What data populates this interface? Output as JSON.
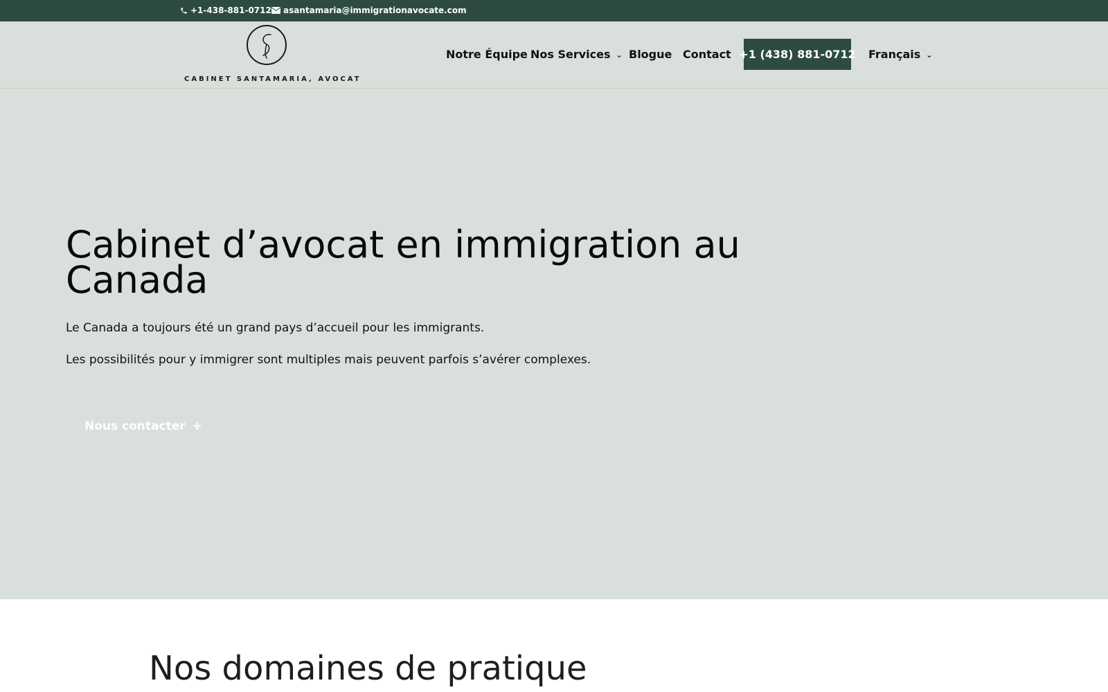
{
  "topbar": {
    "phone": "+1-438-881-0712",
    "email": "asantamaria@immigrationavocate.com",
    "phone_icon": "phone-icon",
    "email_icon": "envelope-icon"
  },
  "header": {
    "logo_text": "CABINET SANTAMARIA, AVOCAT",
    "nav": {
      "team": "Notre Équipe",
      "services": "Nos Services",
      "blog": "Blogue",
      "contact": "Contact",
      "cta_phone": "+1 (438) 881-0712",
      "language": "Français"
    }
  },
  "hero": {
    "title": "Cabinet d’avocat en immigration au Canada",
    "paragraph1": "Le Canada a toujours été un grand pays d’accueil pour les immigrants.",
    "paragraph2": "Les possibilités pour y immigrer sont multiples mais peuvent parfois s’avérer complexes.",
    "button": "Nous contacter",
    "button_symbol": "+"
  },
  "section": {
    "title": "Nos domaines de pratique"
  },
  "colors": {
    "brand_dark_green": "#2d4b43",
    "hero_background": "#d9dfda"
  }
}
